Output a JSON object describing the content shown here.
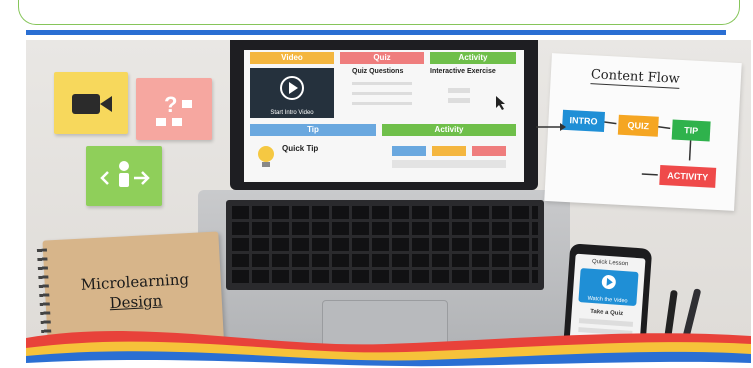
{
  "laptop": {
    "tab_video": "Video",
    "tab_quiz": "Quiz",
    "tab_activity": "Activity",
    "start_video": "Start Intro Video",
    "quiz_questions": "Quiz Questions",
    "interactive_exercise": "Interactive Exercise",
    "tab_tip": "Tip",
    "tab_activity2": "Activity",
    "quick_tip": "Quick Tip"
  },
  "flow": {
    "title": "Content Flow",
    "intro": "INTRO",
    "quiz": "QUIZ",
    "tip": "TIP",
    "activity": "ACTIVITY"
  },
  "notebook": {
    "line1": "Microlearning",
    "line2": "Design"
  },
  "phone": {
    "header": "Quick Lesson",
    "watch": "Watch the Video",
    "take_quiz": "Take a Quiz"
  },
  "colors": {
    "accent_blue": "#2a6fd3",
    "frame_green": "#86c55a",
    "intro_blue": "#1f8fd6",
    "quiz_orange": "#f5a623",
    "tip_green": "#2fb24c",
    "activity_red": "#ef4a4a"
  },
  "icons": [
    "video-camera-icon",
    "question-icon",
    "person-arrows-icon",
    "play-icon",
    "lightbulb-icon",
    "cursor-icon"
  ]
}
